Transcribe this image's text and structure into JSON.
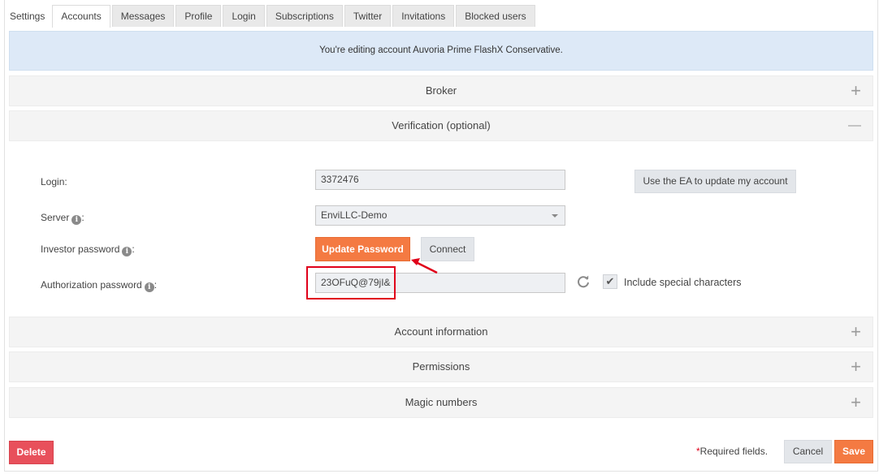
{
  "tabs": [
    {
      "label": "Settings",
      "active": false
    },
    {
      "label": "Accounts",
      "active": true
    },
    {
      "label": "Messages",
      "active": false
    },
    {
      "label": "Profile",
      "active": false
    },
    {
      "label": "Login",
      "active": false
    },
    {
      "label": "Subscriptions",
      "active": false
    },
    {
      "label": "Twitter",
      "active": false
    },
    {
      "label": "Invitations",
      "active": false
    },
    {
      "label": "Blocked users",
      "active": false
    }
  ],
  "banner": "You're editing account Auvoria Prime FlashX Conservative.",
  "panels": {
    "broker": {
      "title": "Broker",
      "sign": "+"
    },
    "verification": {
      "title": "Verification (optional)",
      "sign": "—"
    },
    "account_information": {
      "title": "Account information",
      "sign": "+"
    },
    "permissions": {
      "title": "Permissions",
      "sign": "+"
    },
    "magic_numbers": {
      "title": "Magic numbers",
      "sign": "+"
    }
  },
  "form": {
    "login_label": "Login:",
    "login_value": "3372476",
    "ea_button": "Use the EA to update my account",
    "server_label": "Server",
    "server_value": "EnviLLC-Demo",
    "investor_label": "Investor password",
    "update_password_button": "Update Password",
    "connect_button": "Connect",
    "auth_label": "Authorization password",
    "auth_value": "23OFuQ@79jI&",
    "special_chars_label": "Include special characters",
    "special_chars_checked": true,
    "colon": ":"
  },
  "footer": {
    "delete": "Delete",
    "required_star": "*",
    "required_text": "Required fields.",
    "cancel": "Cancel",
    "save": "Save"
  },
  "colors": {
    "accent_orange": "#f47a42",
    "danger_red": "#e8505b",
    "banner_blue": "#dde9f7",
    "annotation_red": "#e0001a"
  }
}
